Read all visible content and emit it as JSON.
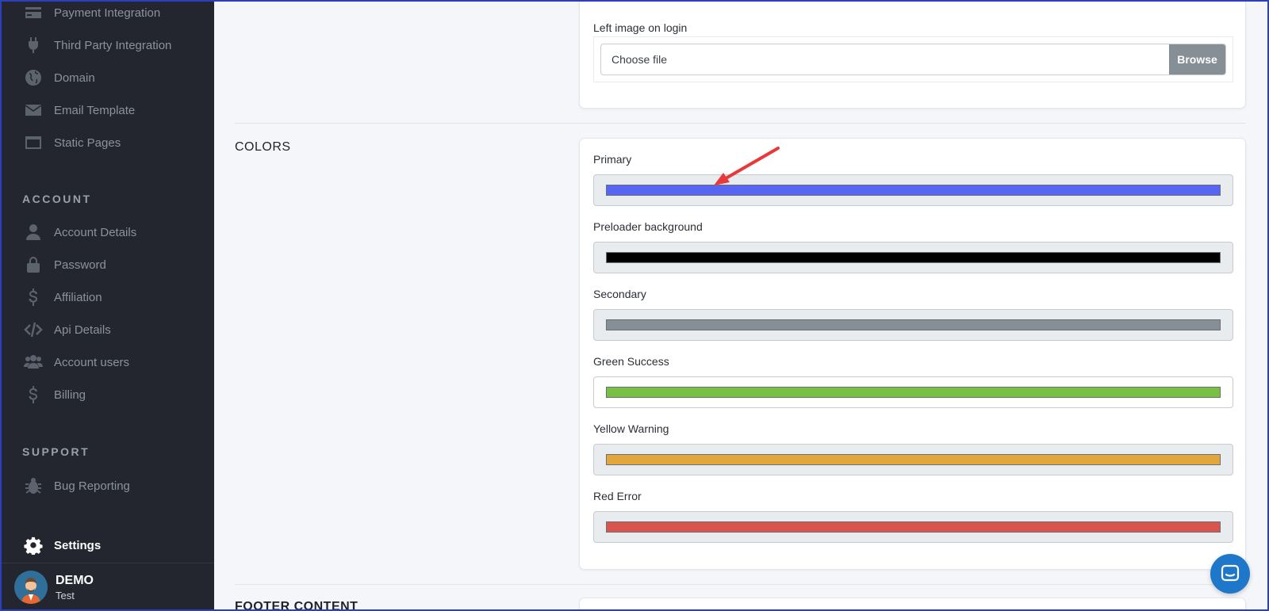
{
  "sidebar": {
    "items_top": [
      {
        "label": "Payment Integration",
        "icon": "credit-card-icon"
      },
      {
        "label": "Third Party Integration",
        "icon": "plug-icon"
      },
      {
        "label": "Domain",
        "icon": "globe-icon"
      },
      {
        "label": "Email Template",
        "icon": "envelope-icon"
      },
      {
        "label": "Static Pages",
        "icon": "window-icon"
      }
    ],
    "account_heading": "ACCOUNT",
    "account_items": [
      {
        "label": "Account Details",
        "icon": "user-icon"
      },
      {
        "label": "Password",
        "icon": "lock-icon"
      },
      {
        "label": "Affiliation",
        "icon": "dollar-icon"
      },
      {
        "label": "Api Details",
        "icon": "code-icon"
      },
      {
        "label": "Account users",
        "icon": "users-icon"
      },
      {
        "label": "Billing",
        "icon": "dollar-icon"
      }
    ],
    "support_heading": "SUPPORT",
    "support_items": [
      {
        "label": "Bug Reporting",
        "icon": "bug-icon"
      }
    ],
    "settings_label": "Settings",
    "user": {
      "name": "DEMO",
      "sub": "Test"
    }
  },
  "main": {
    "login_image": {
      "label": "Left image on login",
      "placeholder": "Choose file",
      "browse_label": "Browse"
    },
    "colors_title": "COLORS",
    "colors": [
      {
        "label": "Primary",
        "value": "#5865f2"
      },
      {
        "label": "Preloader background",
        "value": "#000000"
      },
      {
        "label": "Secondary",
        "value": "#868e96"
      },
      {
        "label": "Green Success",
        "value": "#77c043"
      },
      {
        "label": "Yellow Warning",
        "value": "#e3a63c"
      },
      {
        "label": "Red Error",
        "value": "#d9534f"
      }
    ],
    "footer_title": "FOOTER CONTENT"
  }
}
